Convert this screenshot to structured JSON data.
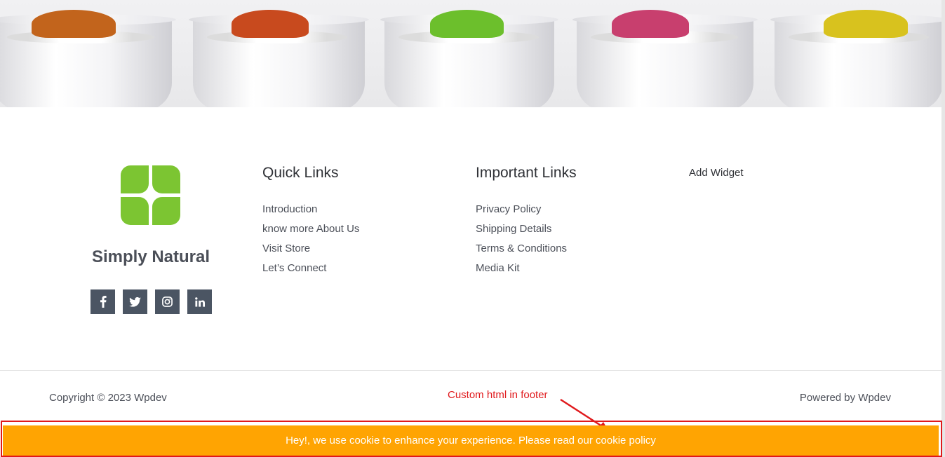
{
  "brand": {
    "name": "Simply Natural",
    "logo_color": "#7cc532"
  },
  "social_links": [
    {
      "icon": "facebook-icon",
      "glyph": "f"
    },
    {
      "icon": "twitter-icon",
      "glyph": "t"
    },
    {
      "icon": "instagram-icon",
      "glyph": "ig"
    },
    {
      "icon": "linkedin-icon",
      "glyph": "in"
    }
  ],
  "quick_links": {
    "title": "Quick Links",
    "items": [
      "Introduction",
      "know more About Us",
      "Visit Store",
      "Let’s Connect"
    ]
  },
  "important_links": {
    "title": "Important Links",
    "items": [
      "Privacy Policy",
      "Shipping Details",
      "Terms & Conditions",
      "Media Kit"
    ]
  },
  "widget_area": {
    "label": "Add Widget"
  },
  "bottom_bar": {
    "copyright": "Copyright © 2023 Wpdev",
    "powered_by": "Powered by Wpdev"
  },
  "annotation": {
    "text": "Custom html in footer",
    "color": "#e0191c"
  },
  "cookie_notice": {
    "text": "Hey!, we use cookie to enhance your experience. Please read our cookie policy",
    "background": "#ffa402"
  }
}
